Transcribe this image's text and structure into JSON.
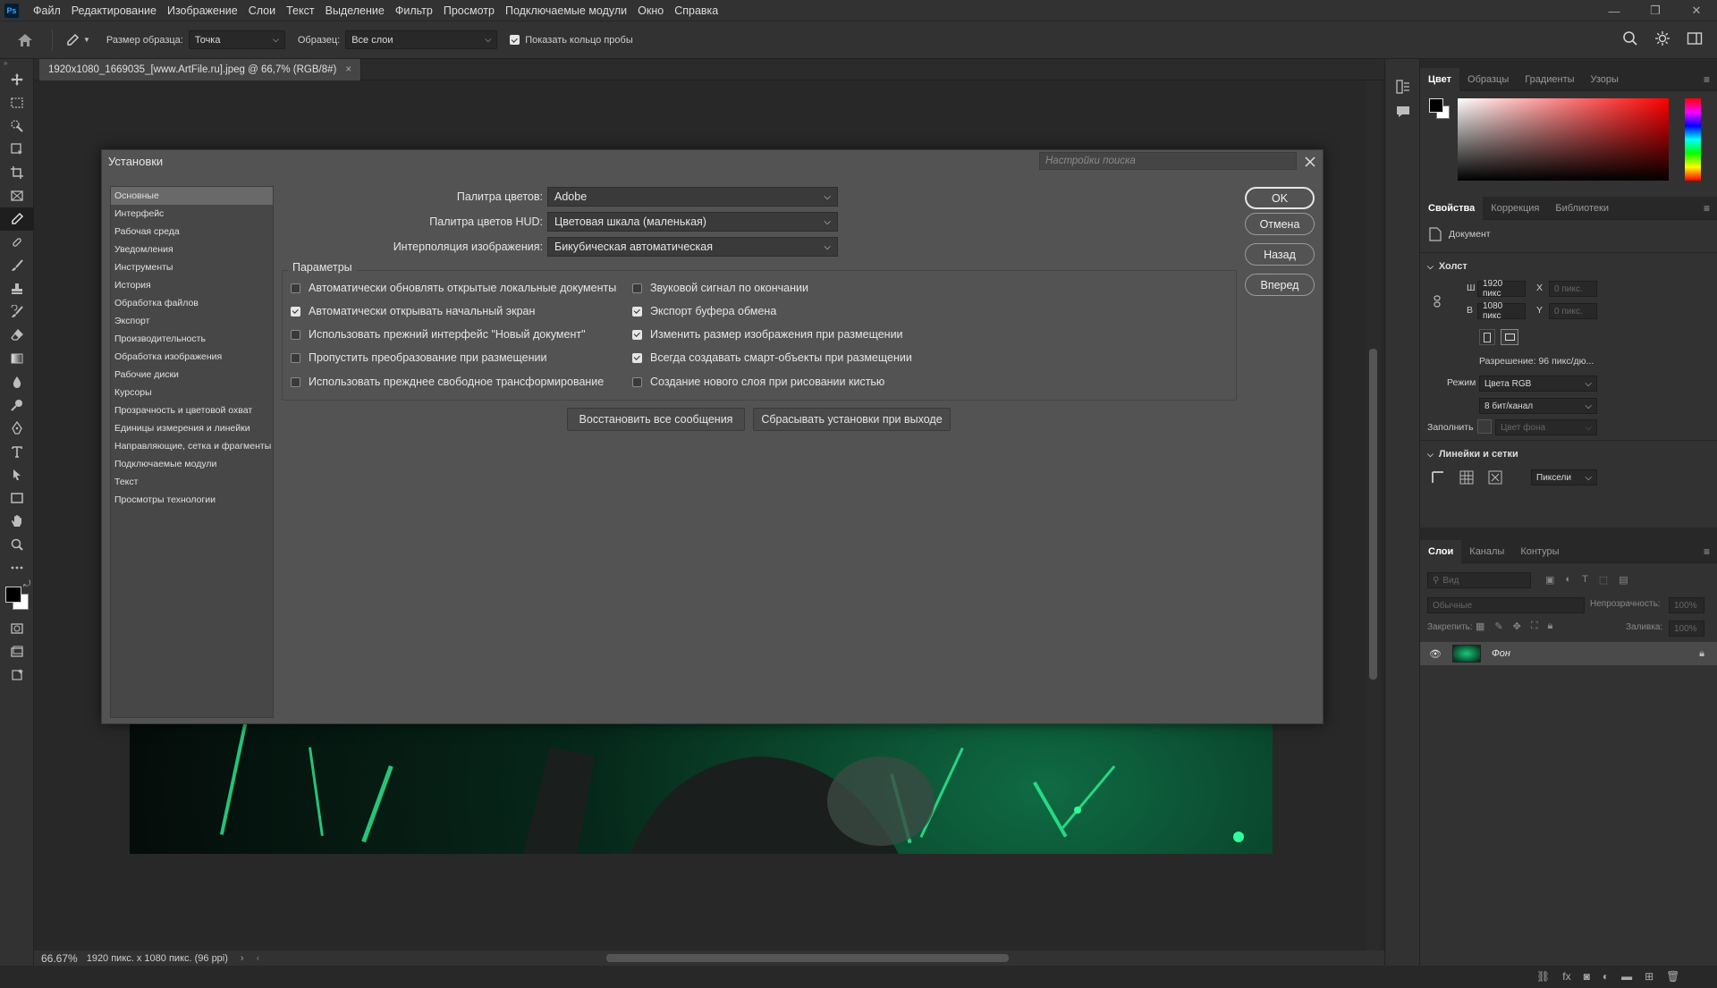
{
  "menubar": {
    "logo": "Ps",
    "items": [
      "Файл",
      "Редактирование",
      "Изображение",
      "Слои",
      "Текст",
      "Выделение",
      "Фильтр",
      "Просмотр",
      "Подключаемые модули",
      "Окно",
      "Справка"
    ]
  },
  "options_bar": {
    "sample_size_label": "Размер образца:",
    "sample_size_value": "Точка",
    "sample_label": "Образец:",
    "sample_value": "Все слои",
    "show_ring_label": "Показать кольцо пробы"
  },
  "document": {
    "tab_title": "1920x1080_1669035_[www.ArtFile.ru].jpeg @ 66,7% (RGB/8#)",
    "zoom": "66.67%",
    "size_info": "1920 пикс. x 1080 пикс. (96 ppi)"
  },
  "dialog": {
    "title": "Установки",
    "search_placeholder": "Настройки поиска",
    "nav_items": [
      "Основные",
      "Интерфейс",
      "Рабочая среда",
      "Уведомления",
      "Инструменты",
      "История",
      "Обработка файлов",
      "Экспорт",
      "Производительность",
      "Обработка изображения",
      "Рабочие диски",
      "Курсоры",
      "Прозрачность и цветовой охват",
      "Единицы измерения и линейки",
      "Направляющие, сетка и фрагменты",
      "Подключаемые модули",
      "Текст",
      "Просмотры технологии"
    ],
    "color_picker_label": "Палитра цветов:",
    "color_picker_value": "Adobe",
    "hud_picker_label": "Палитра цветов HUD:",
    "hud_picker_value": "Цветовая шкала (маленькая)",
    "interp_label": "Интерполяция изображения:",
    "interp_value": "Бикубическая автоматическая",
    "options_legend": "Параметры",
    "options_left": [
      {
        "label": "Автоматически обновлять открытые локальные документы",
        "checked": false
      },
      {
        "label": "Автоматически открывать начальный экран",
        "checked": true
      },
      {
        "label": "Использовать прежний интерфейс \"Новый документ\"",
        "checked": false
      },
      {
        "label": "Пропустить преобразование при размещении",
        "checked": false
      },
      {
        "label": "Использовать прежднее свободное трансформирование",
        "checked": false
      }
    ],
    "options_right": [
      {
        "label": "Звуковой сигнал по окончании",
        "checked": false
      },
      {
        "label": "Экспорт буфера обмена",
        "checked": true
      },
      {
        "label": "Изменить размер изображения при размещении",
        "checked": true
      },
      {
        "label": "Всегда создавать смарт-объекты при размещении",
        "checked": true
      },
      {
        "label": "Создание нового слоя при рисовании кистью",
        "checked": false
      }
    ],
    "restore_button": "Восстановить все сообщения",
    "reset_button": "Сбрасывать установки при выходе",
    "ok_button": "OK",
    "cancel_button": "Отмена",
    "back_button": "Назад",
    "forward_button": "Вперед"
  },
  "color_panel": {
    "tabs": [
      "Цвет",
      "Образцы",
      "Градиенты",
      "Узоры"
    ]
  },
  "properties_panel": {
    "tabs": [
      "Свойства",
      "Коррекция",
      "Библиотеки"
    ],
    "doc_label": "Документ",
    "canvas_header": "Холст",
    "w_label": "Ш",
    "w_value": "1920 пикс",
    "h_label": "В",
    "h_value": "1080 пикс",
    "x_label": "X",
    "x_value": "0 пикс.",
    "y_label": "Y",
    "y_value": "0 пикс.",
    "resolution": "Разрешение: 96 пикс/дю...",
    "mode_label": "Режим",
    "mode_value": "Цвета RGB",
    "depth_value": "8 бит/канал",
    "fill_label": "Заполнить",
    "fill_value": "Цвет фона",
    "rulers_header": "Линейки и сетки",
    "units_value": "Пиксели"
  },
  "layers_panel": {
    "tabs": [
      "Слои",
      "Каналы",
      "Контуры"
    ],
    "search_placeholder": "Вид",
    "blend_mode": "Обычные",
    "opacity_label": "Непрозрачность:",
    "opacity_value": "100%",
    "lock_label": "Закрепить:",
    "fill_label": "Заливка:",
    "fill_value": "100%",
    "layer_name": "Фон"
  }
}
